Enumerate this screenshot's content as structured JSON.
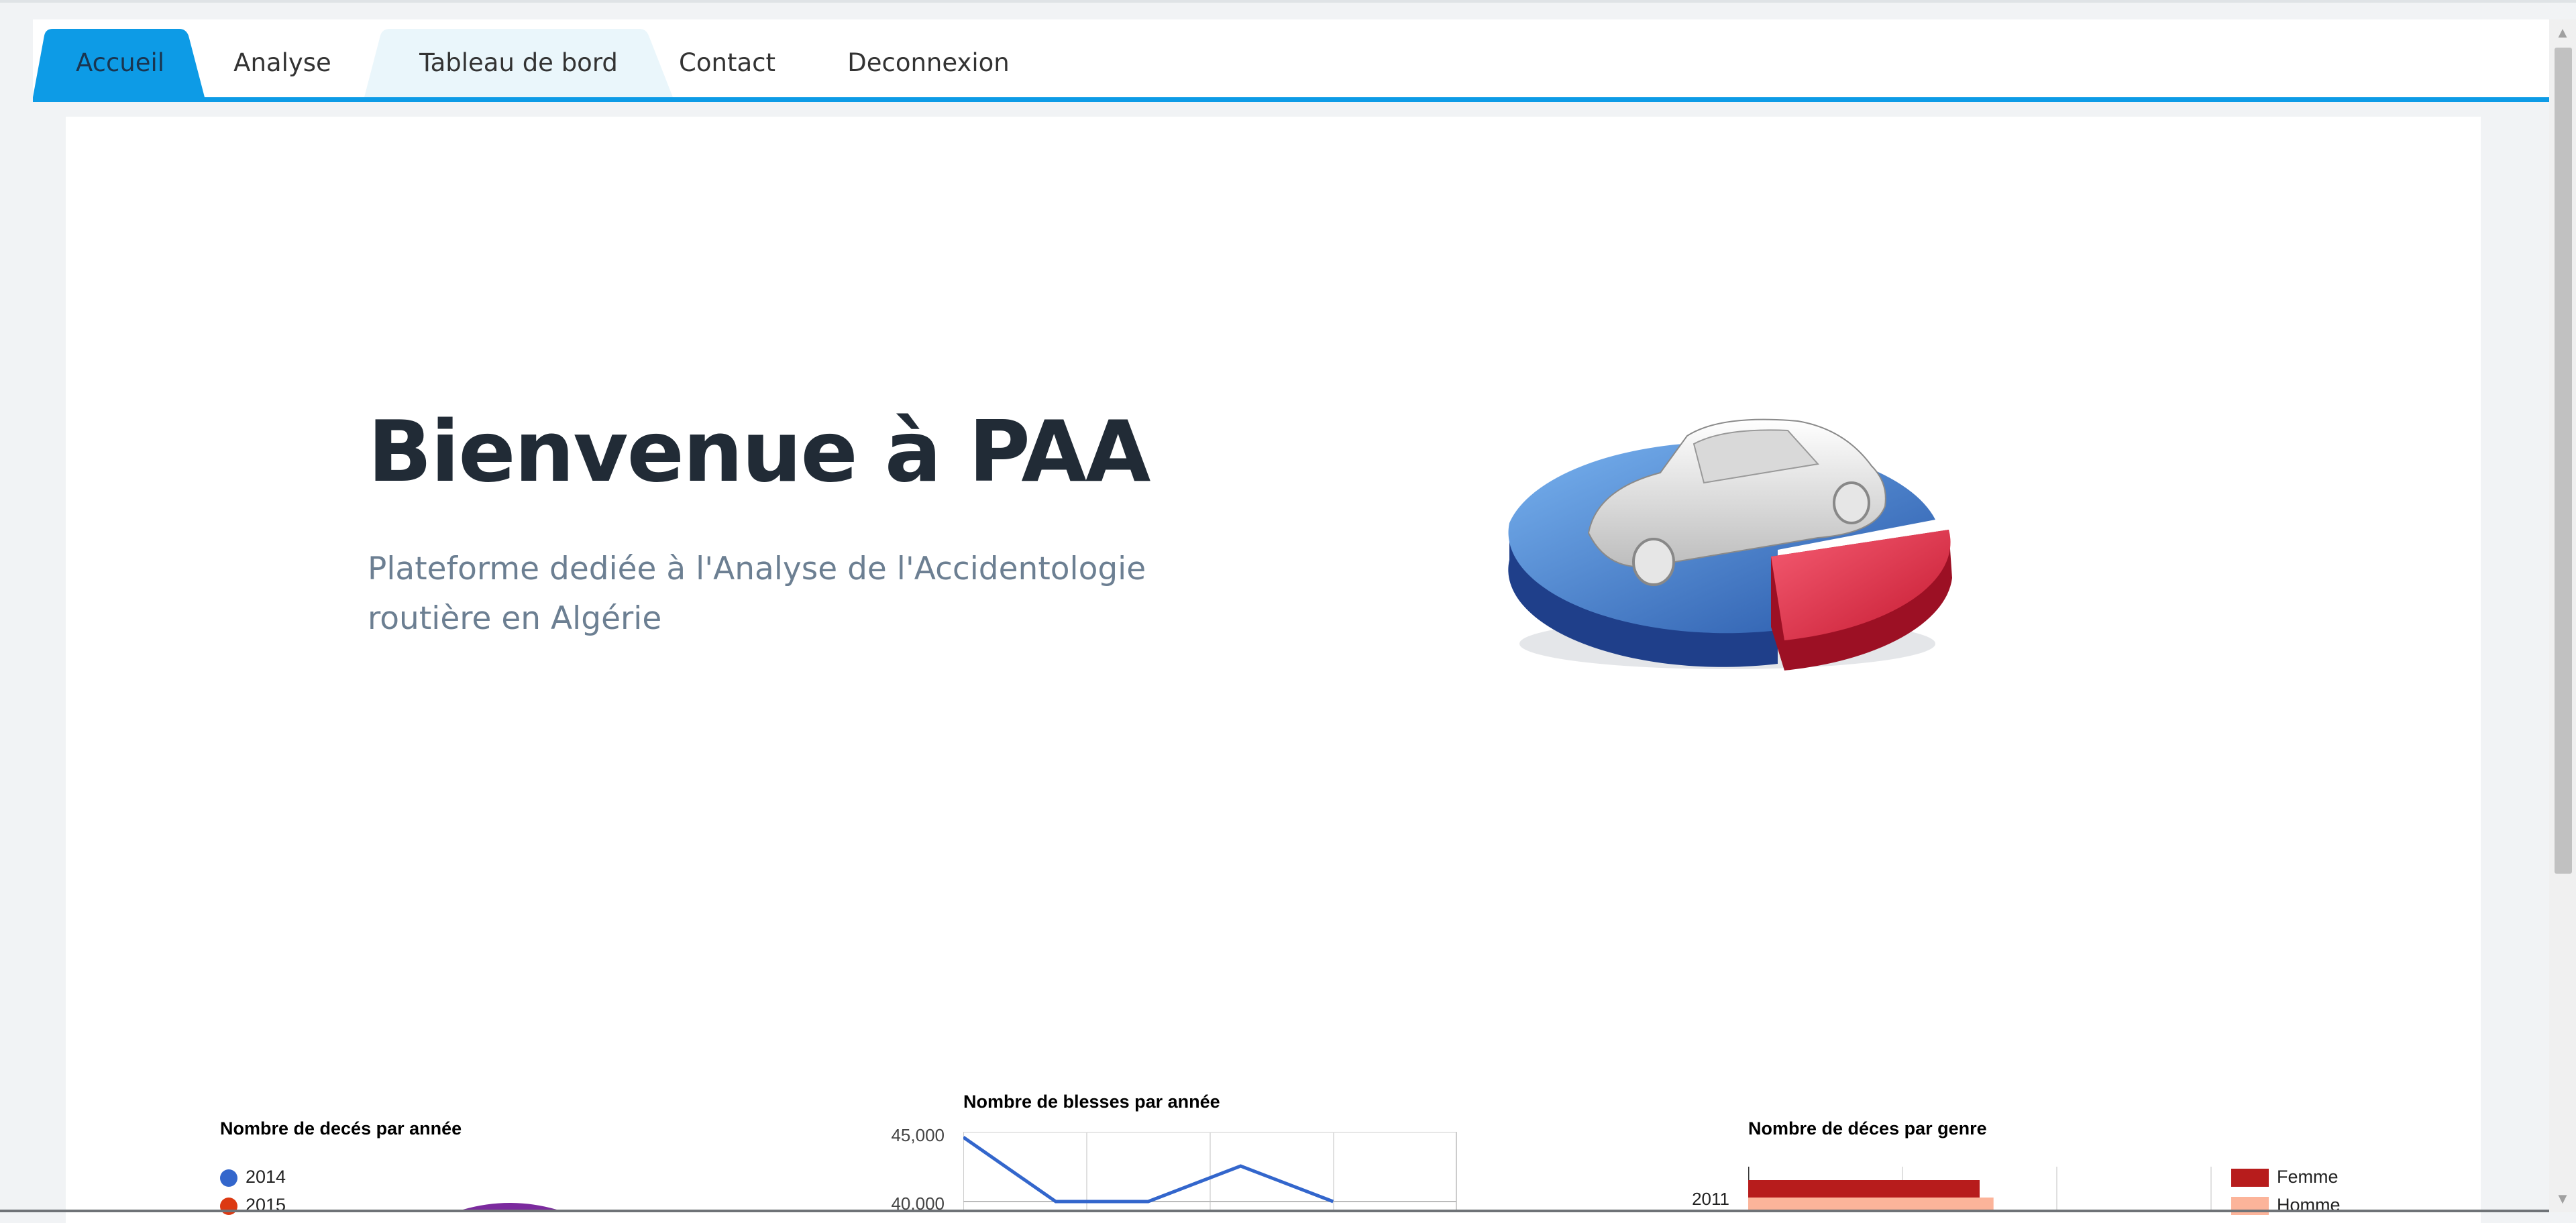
{
  "nav": {
    "tabs": [
      {
        "label": "Accueil",
        "active": true
      },
      {
        "label": "Analyse",
        "active": false
      },
      {
        "label": "Tableau de bord",
        "active": false
      },
      {
        "label": "Contact",
        "active": false
      },
      {
        "label": "Deconnexion",
        "active": false
      }
    ]
  },
  "hero": {
    "title": "Bienvenue à PAA",
    "subtitle": "Plateforme dediée à l'Analyse de l'Accidentologie routière en Algérie",
    "image_icon": "car-pie-chart-icon"
  },
  "charts": {
    "deaths_per_year": {
      "title": "Nombre de decés par année"
    },
    "injured_per_year": {
      "title": "Nombre de blesses par année"
    },
    "deaths_by_gender": {
      "title": "Nombre de déces par genre"
    }
  },
  "colors": {
    "accent": "#0d9be6",
    "title": "#212b36",
    "subtitle": "#6c7f92",
    "pie_2014": "#3366cc",
    "pie_2015": "#dc3912",
    "line": "#3366cc",
    "femme": "#b71c1c",
    "homme": "#fcb49a"
  },
  "chart_data": [
    {
      "type": "pie",
      "title": "Nombre de decés par année",
      "legend": [
        "2014",
        "2015"
      ],
      "legend_position": "left"
    },
    {
      "type": "line",
      "title": "Nombre de blesses par année",
      "y_ticks": [
        "45,000",
        "40,000"
      ],
      "y_tick_values": [
        45000,
        40000
      ],
      "ylim": [
        40000,
        45000
      ],
      "series": [
        {
          "values": [
            44700,
            40000,
            40000,
            42600,
            40000
          ]
        }
      ],
      "grid": true
    },
    {
      "type": "bar",
      "orientation": "horizontal",
      "title": "Nombre de déces par genre",
      "categories": [
        "2011"
      ],
      "series": [
        {
          "name": "Femme",
          "values": [
            1500
          ]
        },
        {
          "name": "Homme",
          "values": [
            1590
          ]
        }
      ],
      "xlim": [
        0,
        3000
      ],
      "legend_position": "right"
    }
  ]
}
